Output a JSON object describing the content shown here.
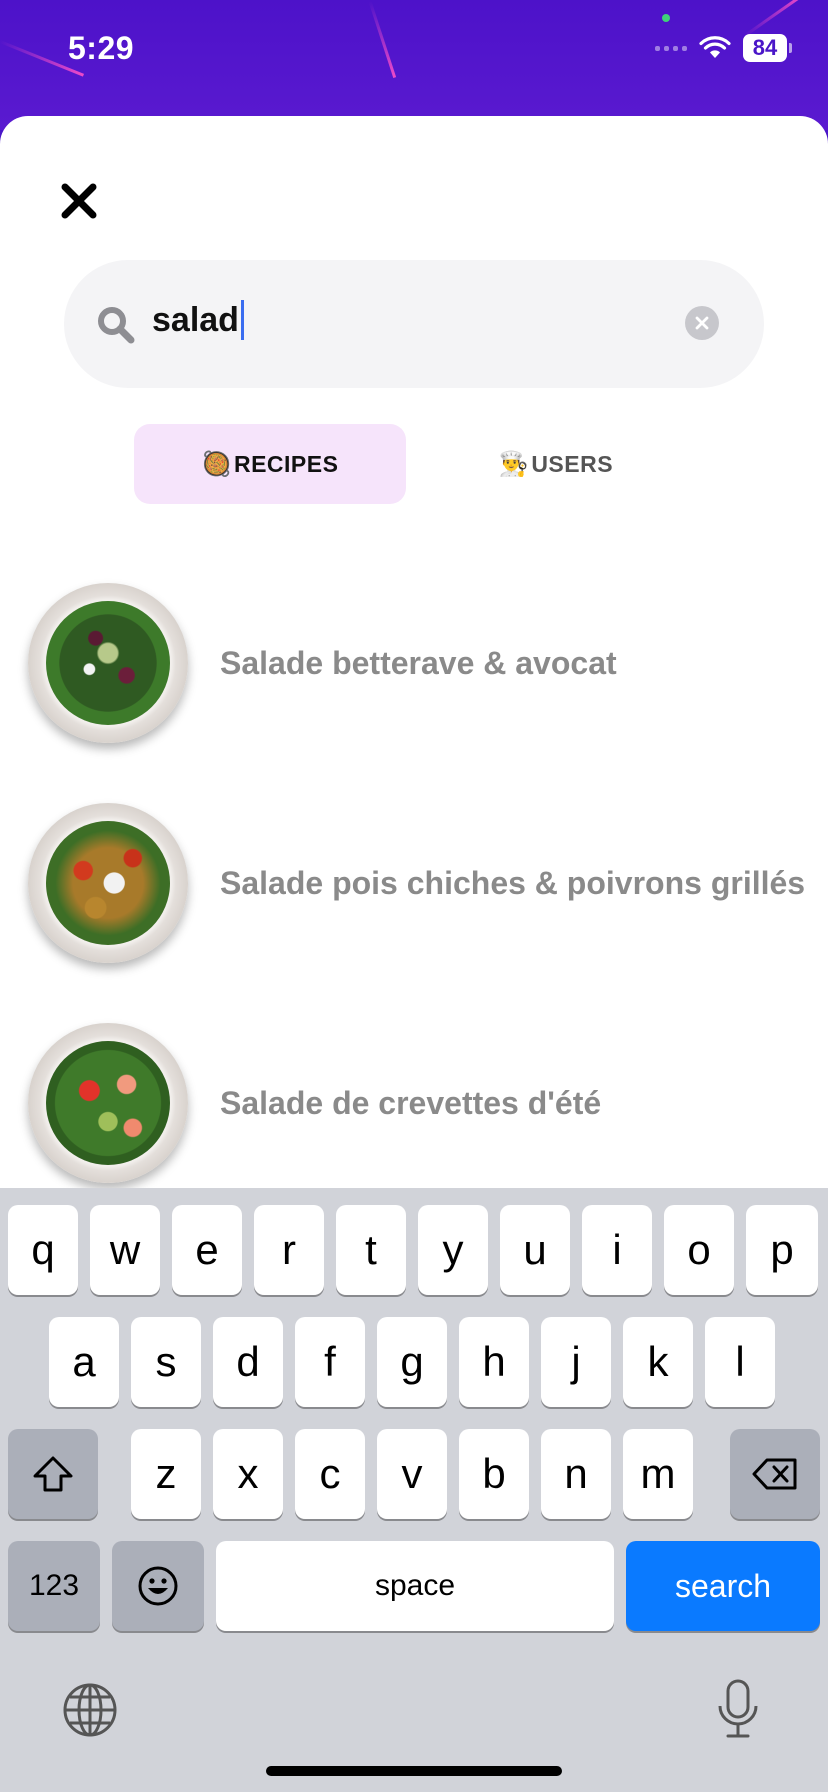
{
  "status_bar": {
    "time": "5:29",
    "battery": "84"
  },
  "search": {
    "query": "salad"
  },
  "tabs": [
    {
      "emoji": "🥘",
      "label": "RECIPES",
      "active": true
    },
    {
      "emoji": "👨‍🍳",
      "label": "USERS",
      "active": false
    }
  ],
  "results": [
    {
      "title": "Salade  betterave & avocat"
    },
    {
      "title": "Salade pois chiches & poivrons grillés"
    },
    {
      "title": "Salade de crevettes d'été"
    }
  ],
  "keyboard": {
    "row1": [
      "q",
      "w",
      "e",
      "r",
      "t",
      "y",
      "u",
      "i",
      "o",
      "p"
    ],
    "row2": [
      "a",
      "s",
      "d",
      "f",
      "g",
      "h",
      "j",
      "k",
      "l"
    ],
    "row3": [
      "z",
      "x",
      "c",
      "v",
      "b",
      "n",
      "m"
    ],
    "numbers_label": "123",
    "space_label": "space",
    "search_label": "search"
  },
  "colors": {
    "header_purple": "#4a16c8",
    "tab_active_bg": "#f6e4fb",
    "search_key_blue": "#0a7aff"
  }
}
